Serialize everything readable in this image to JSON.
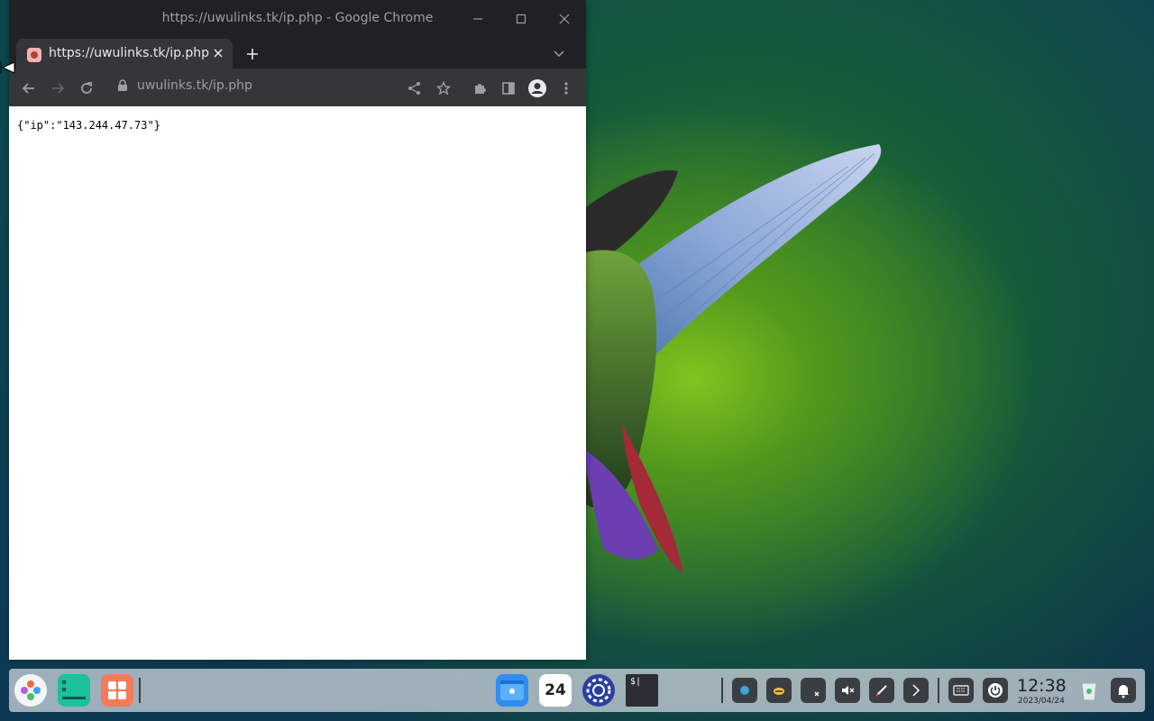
{
  "window": {
    "title": "https://uwulinks.tk/ip.php - Google Chrome"
  },
  "tabs": [
    {
      "label": "https://uwulinks.tk/ip.php",
      "active": true
    }
  ],
  "toolbar": {
    "url": "uwulinks.tk/ip.php"
  },
  "page": {
    "body_text": "{\"ip\":\"143.244.47.73\"}"
  },
  "taskbar": {
    "clock_time": "12:38",
    "clock_date": "2023/04/24",
    "calendar_day": "24",
    "terminal_glyph": "$|"
  },
  "colors": {
    "chrome_frame": "#202124",
    "chrome_toolbar": "#35363a",
    "taskbar": "#c8d0d8"
  }
}
